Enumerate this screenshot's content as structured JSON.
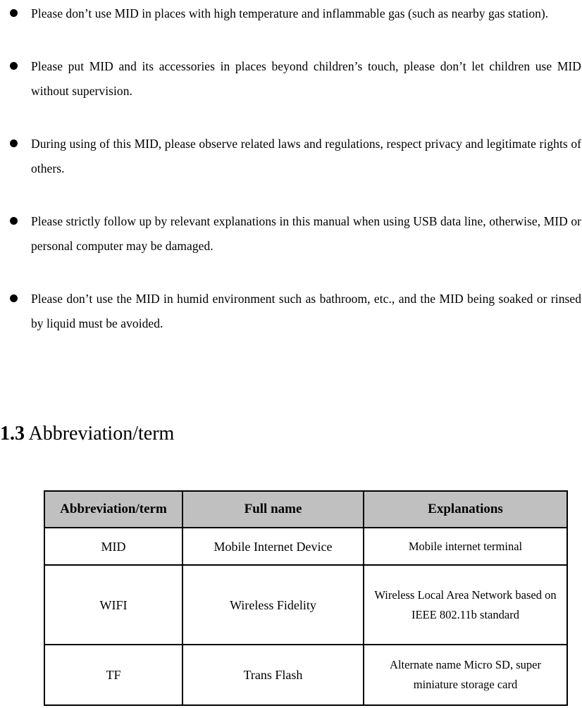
{
  "document": {
    "bullets": [
      {
        "id": "bullet-temperature",
        "text": "Please don’t use MID in places with high temperature and inflammable gas (such as nearby gas station)."
      },
      {
        "id": "bullet-children",
        "text": "Please put MID and its accessories in places beyond children’s touch, please don’t let children use MID without supervision."
      },
      {
        "id": "bullet-laws",
        "text": "During using of this MID, please observe related laws and regulations, respect privacy and legitimate rights of others."
      },
      {
        "id": "bullet-usb",
        "text": "Please strictly follow up by relevant explanations in this manual when using USB data line, otherwise, MID or personal computer may be damaged."
      },
      {
        "id": "bullet-humid",
        "text": "Please don’t use the MID in humid environment such as bathroom, etc., and the MID being soaked or rinsed by liquid must be avoided."
      }
    ],
    "heading": {
      "number": "1.3",
      "title": "Abbreviation/term"
    },
    "table": {
      "headers": [
        "Abbreviation/term",
        "Full name",
        "Explanations"
      ],
      "rows": [
        {
          "abbreviation": "MID",
          "full_name": "Mobile Internet Device",
          "explanation": "Mobile internet terminal"
        },
        {
          "abbreviation": "WIFI",
          "full_name": "Wireless Fidelity",
          "explanation": "Wireless Local Area Network based on IEEE 802.11b standard"
        },
        {
          "abbreviation": "TF",
          "full_name": "Trans Flash",
          "explanation": "Alternate name Micro SD, super miniature storage card"
        }
      ],
      "header_background": "#C0C0C0",
      "border_color": "#000000"
    }
  }
}
